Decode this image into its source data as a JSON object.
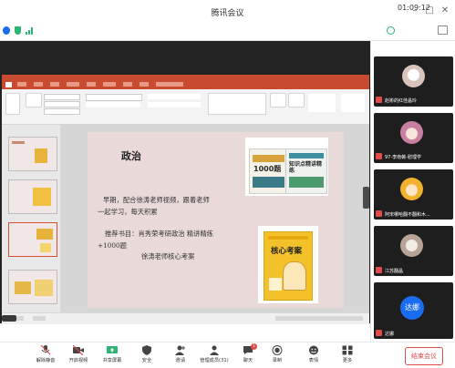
{
  "app": {
    "title": "腾讯会议"
  },
  "meeting": {
    "elapsed": "01:09:12"
  },
  "slide": {
    "title": "政治",
    "lines": [
      "早期，配合徐涛老师视频，跟着老师",
      "一起学习，每天积累",
      "推荐书目：肖秀荣考研政治 精讲精练",
      "+1000题",
      "徐涛老师核心考案"
    ],
    "book1": {
      "label": "1000题",
      "subtitle": "知识点精讲精练"
    },
    "book2": {
      "label": "核心考案"
    }
  },
  "participants": [
    {
      "name": "赵彬的红佳晶玲"
    },
    {
      "name": "97-李南薇-慰理学"
    },
    {
      "name": "阿宋哪哈翻不翻和木..."
    },
    {
      "name": "江苏翻晶"
    },
    {
      "name": "达娜",
      "avatar_text": "达娜"
    }
  ],
  "toolbar": [
    {
      "label": "解除静音",
      "icon": "mic-muted-icon"
    },
    {
      "label": "开启视频",
      "icon": "video-off-icon"
    },
    {
      "label": "共享屏幕",
      "icon": "share-screen-icon"
    },
    {
      "label": "安全",
      "icon": "shield-icon"
    },
    {
      "label": "邀请",
      "icon": "invite-icon"
    },
    {
      "label": "管理成员(31)",
      "icon": "members-icon"
    },
    {
      "label": "聊天",
      "icon": "chat-icon",
      "badge": "1"
    },
    {
      "label": "录制",
      "icon": "record-icon"
    },
    {
      "label": "表情",
      "icon": "emoji-icon"
    },
    {
      "label": "更多",
      "icon": "more-icon"
    }
  ],
  "end_button": "结束会议",
  "colors": {
    "ppt_red": "#c84a31",
    "end_red": "#e04b4b",
    "accent_blue": "#1a6cf0"
  }
}
